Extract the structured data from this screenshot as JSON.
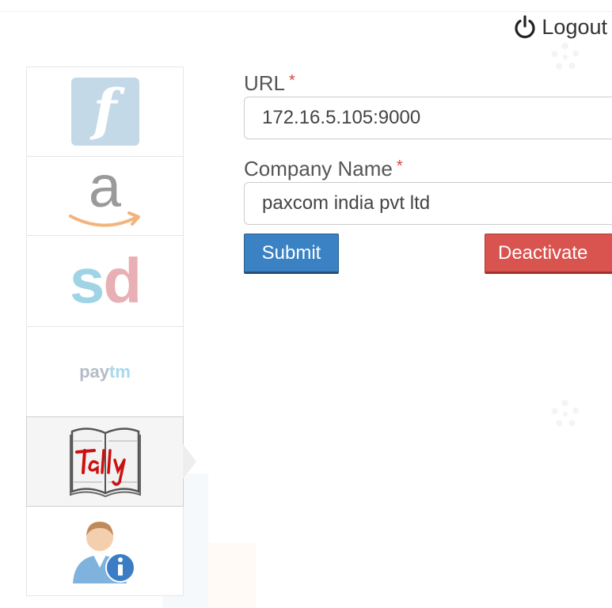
{
  "header": {
    "logout_label": "Logout",
    "logout_icon": "power-icon"
  },
  "sidebar": {
    "items": [
      {
        "id": "flipkart",
        "icon": "flipkart-logo-icon",
        "active": false
      },
      {
        "id": "amazon",
        "icon": "amazon-logo-icon",
        "logo_text": "a",
        "active": false
      },
      {
        "id": "snapdeal",
        "icon": "snapdeal-logo-icon",
        "logo_text_1": "s",
        "logo_text_2": "d",
        "active": false
      },
      {
        "id": "paytm",
        "icon": "paytm-logo-icon",
        "logo_text_1": "pay",
        "logo_text_2": "tm",
        "active": false
      },
      {
        "id": "tally",
        "icon": "tally-logo-icon",
        "active": true
      },
      {
        "id": "user-info",
        "icon": "user-info-icon",
        "active": false
      }
    ],
    "flipkart_letter": "f"
  },
  "form": {
    "url_label": "URL",
    "url_required": "*",
    "url_value": "172.16.5.105:9000",
    "company_label": "Company Name",
    "company_required": "*",
    "company_value": "paxcom india pvt ltd",
    "submit_label": "Submit",
    "deactivate_label": "Deactivate"
  },
  "colors": {
    "submit": "#3a82c4",
    "deactivate": "#d9534f",
    "required": "#e04040"
  }
}
